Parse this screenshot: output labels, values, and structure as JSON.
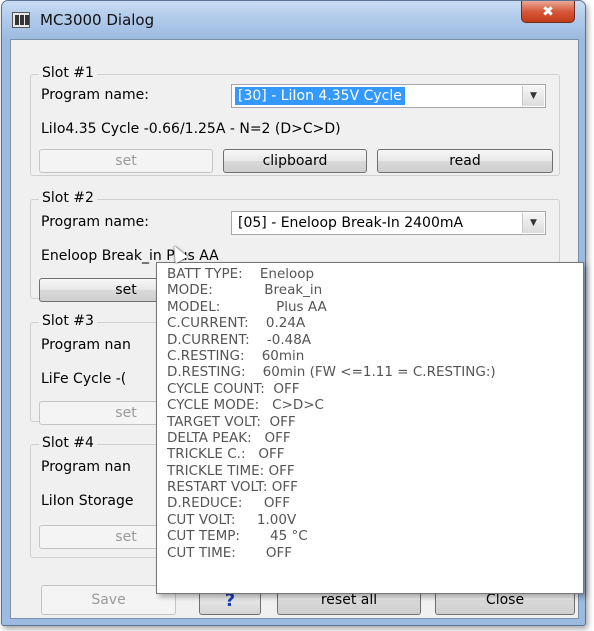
{
  "window": {
    "title": "MC3000 Dialog",
    "close_glyph": "✖"
  },
  "slots": [
    {
      "title": "Slot #1",
      "program_label": "Program name:",
      "program_value": "[30] - LiIon 4.35V Cycle",
      "description": "LiIo4.35  Cycle  -0.66/1.25A - N=2 (D>C>D)",
      "set_label": "set",
      "clipboard_label": "clipboard",
      "read_label": "read"
    },
    {
      "title": "Slot #2",
      "program_label": "Program name:",
      "program_value": "[05] - Eneloop Break-In 2400mA",
      "description": "Eneloop  Break_in  Plus AA",
      "set_label": "set"
    },
    {
      "title": "Slot #3",
      "program_label": "Program nan",
      "description": "LiFe Cycle -(",
      "set_label": "set"
    },
    {
      "title": "Slot #4",
      "program_label": "Program nan",
      "description": "LiIon Storage",
      "set_label": "set"
    }
  ],
  "footer": {
    "save_label": "Save",
    "help_glyph": "?",
    "reset_all_label": "reset all",
    "close_label": "Close"
  },
  "tooltip": {
    "rows": [
      {
        "key": "BATT TYPE:    ",
        "value": "Eneloop"
      },
      {
        "key": "MODE:            ",
        "value": "Break_in"
      },
      {
        "key": "MODEL:             ",
        "value": "Plus AA"
      },
      {
        "key": "C.CURRENT:    ",
        "value": "0.24A"
      },
      {
        "key": "D.CURRENT:    ",
        "value": "-0.48A"
      },
      {
        "key": "C.RESTING:    ",
        "value": "60min"
      },
      {
        "key": "D.RESTING:    ",
        "value": "60min (FW <=1.11 = C.RESTING:)"
      },
      {
        "key": "CYCLE COUNT:  ",
        "value": "OFF"
      },
      {
        "key": "CYCLE MODE:   ",
        "value": "C>D>C"
      },
      {
        "key": "TARGET VOLT:  ",
        "value": "OFF"
      },
      {
        "key": "DELTA PEAK:   ",
        "value": "OFF"
      },
      {
        "key": "TRICKLE C.:   ",
        "value": "OFF"
      },
      {
        "key": "TRICKLE TIME: ",
        "value": "OFF"
      },
      {
        "key": "RESTART VOLT: ",
        "value": "OFF"
      },
      {
        "key": "D.REDUCE:     ",
        "value": "OFF"
      },
      {
        "key": "CUT VOLT:     ",
        "value": "1.00V"
      },
      {
        "key": "CUT TEMP:       ",
        "value": "45 °C"
      },
      {
        "key": "CUT TIME:       ",
        "value": "OFF"
      }
    ]
  }
}
